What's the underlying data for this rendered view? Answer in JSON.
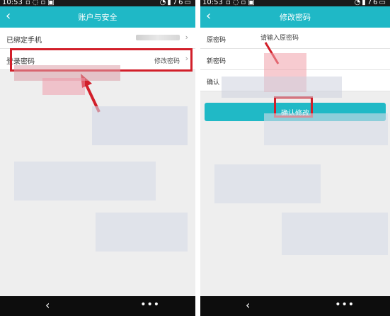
{
  "left": {
    "status_time": "10:53",
    "battery": "76",
    "title": "账户与安全",
    "rows": [
      {
        "label": "已绑定手机",
        "value": ""
      },
      {
        "label": "登录密码",
        "value": "修改密码"
      }
    ],
    "chevron": "›",
    "nav_back": "‹",
    "nav_more": "•••"
  },
  "right": {
    "status_time": "10:53",
    "battery": "76",
    "title": "修改密码",
    "fields": [
      {
        "label": "原密码",
        "placeholder": "请输入原密码"
      },
      {
        "label": "新密码",
        "placeholder": ""
      },
      {
        "label": "确认",
        "placeholder": ""
      }
    ],
    "confirm_label": "确认修改",
    "nav_back": "‹",
    "nav_more": "•••"
  },
  "colors": {
    "accent": "#1fb8c6",
    "highlight": "#d21f2a"
  },
  "icons": [
    "back-icon",
    "chevron-right-icon",
    "wifi-icon",
    "signal-icon",
    "battery-icon",
    "menu-dots-icon"
  ]
}
